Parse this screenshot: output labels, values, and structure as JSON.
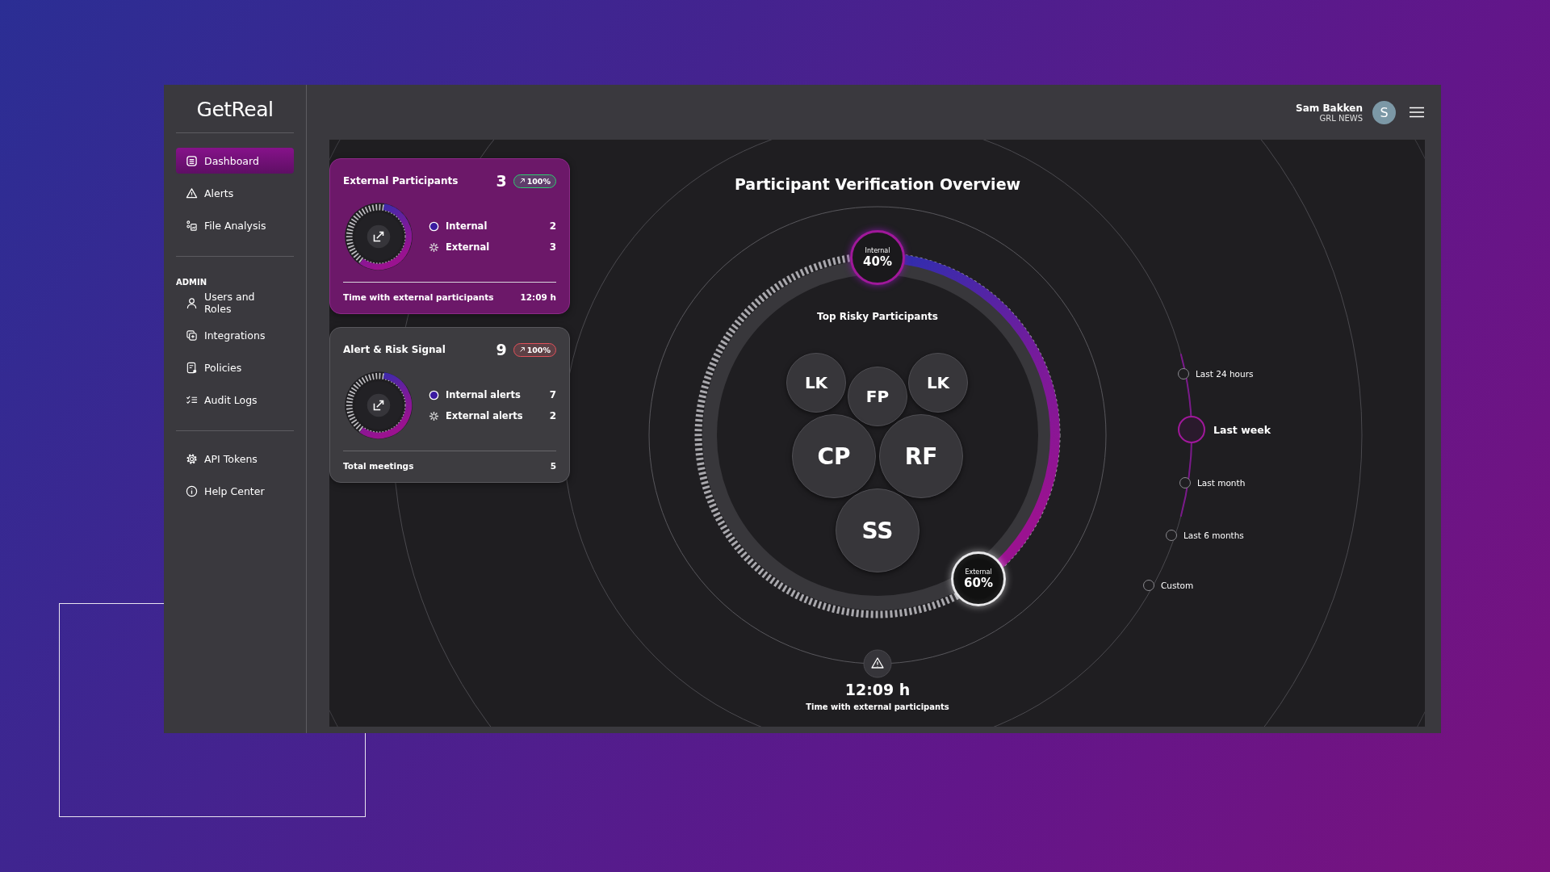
{
  "brand": {
    "logo": "GetReal"
  },
  "nav": [
    {
      "label": "Dashboard",
      "selected": true
    },
    {
      "label": "Alerts",
      "selected": false
    },
    {
      "label": "File Analysis",
      "selected": false
    }
  ],
  "admin": {
    "heading": "ADMIN",
    "items": [
      {
        "label": "Users and Roles",
        "selected": false
      },
      {
        "label": "Integrations",
        "selected": false
      },
      {
        "label": "Policies",
        "selected": false
      },
      {
        "label": "Audit Logs",
        "selected": false
      }
    ]
  },
  "footer_nav": [
    {
      "label": "API Tokens",
      "selected": false
    },
    {
      "label": "Help Center",
      "selected": false
    }
  ],
  "header": {
    "user_name": "Sam Bakken",
    "org": "GRL NEWS",
    "avatar": "S"
  },
  "cards": [
    {
      "title": "External Participants",
      "count": "3",
      "badge": {
        "text": "100%",
        "color": "#2ecc71"
      },
      "selected": true,
      "legend": [
        {
          "kind": "internal",
          "label": "Internal",
          "value": "2"
        },
        {
          "kind": "external",
          "label": "External",
          "value": "3"
        }
      ],
      "footer_label": "Time with external participants",
      "footer_value": "12:09 h"
    },
    {
      "title": "Alert & Risk Signal",
      "count": "9",
      "badge": {
        "text": "100%",
        "color": "#e0505a"
      },
      "selected": false,
      "legend": [
        {
          "kind": "internal",
          "label": "Internal alerts",
          "value": "7"
        },
        {
          "kind": "external",
          "label": "External alerts",
          "value": "2"
        }
      ],
      "footer_label": "Total meetings",
      "footer_value": "5"
    }
  ],
  "overview": {
    "title": "Participant Verification Overview",
    "internal": {
      "label": "Internal",
      "value": "40%"
    },
    "external": {
      "label": "External",
      "value": "60%"
    },
    "subtitle": "Top Risky Participants",
    "participants": [
      "LK",
      "FP",
      "LK",
      "CP",
      "RF",
      "SS"
    ],
    "time": "12:09 h",
    "time_caption": "Time with external participants"
  },
  "time_ranges": [
    {
      "label": "Last 24 hours",
      "selected": false
    },
    {
      "label": "Last week",
      "selected": true
    },
    {
      "label": "Last month",
      "selected": false
    },
    {
      "label": "Last 6 months",
      "selected": false
    },
    {
      "label": "Custom",
      "selected": false
    }
  ]
}
